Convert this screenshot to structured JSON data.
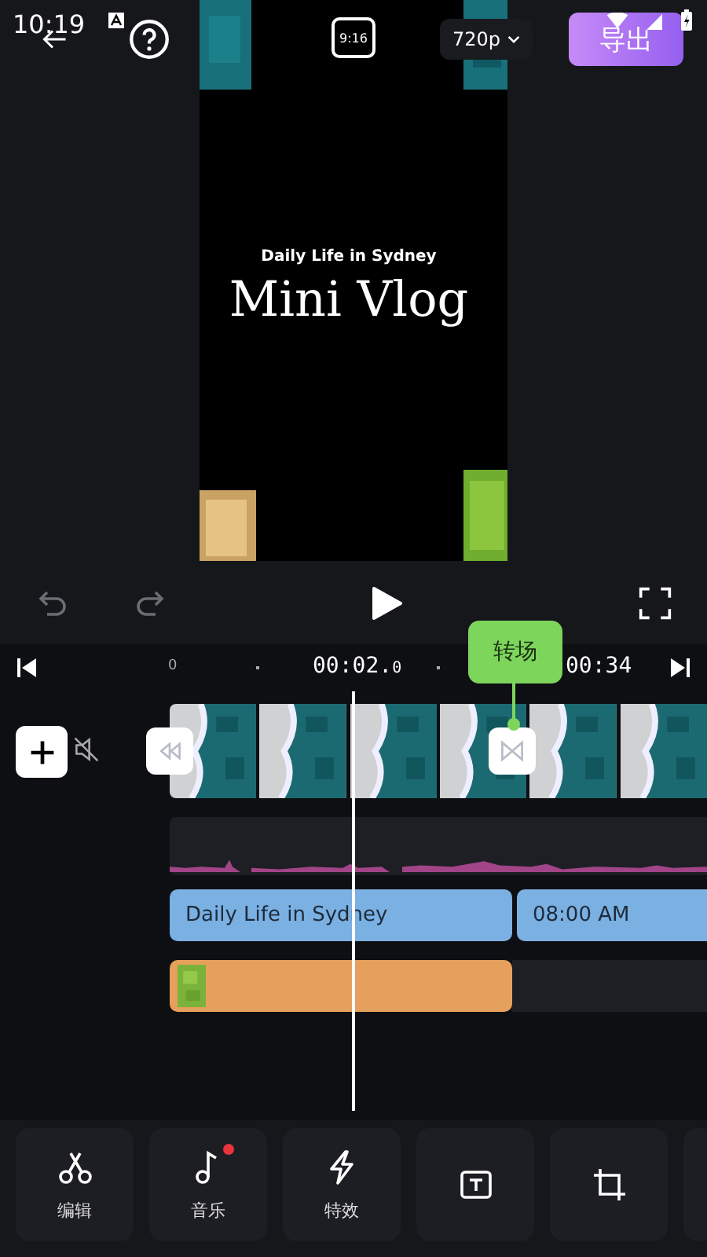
{
  "status_bar": {
    "time": "10:19"
  },
  "top_bar": {
    "aspect": "9:16",
    "resolution": "720p",
    "export": "导出"
  },
  "preview": {
    "subtitle": "Daily Life in Sydney",
    "title": "Mini Vlog"
  },
  "ruler": {
    "start": "0",
    "current": "00:02.",
    "current_fraction": "0",
    "end": "00:34"
  },
  "tooltip": "转场",
  "text_clips": [
    "Daily Life in Sydney",
    "08:00 AM"
  ],
  "tools": [
    {
      "kind": "scissors",
      "label": "编辑",
      "badge": false
    },
    {
      "kind": "note",
      "label": "音乐",
      "badge": true
    },
    {
      "kind": "bolt",
      "label": "特效",
      "badge": false
    },
    {
      "kind": "text",
      "badge": false
    },
    {
      "kind": "crop",
      "badge": false
    }
  ]
}
